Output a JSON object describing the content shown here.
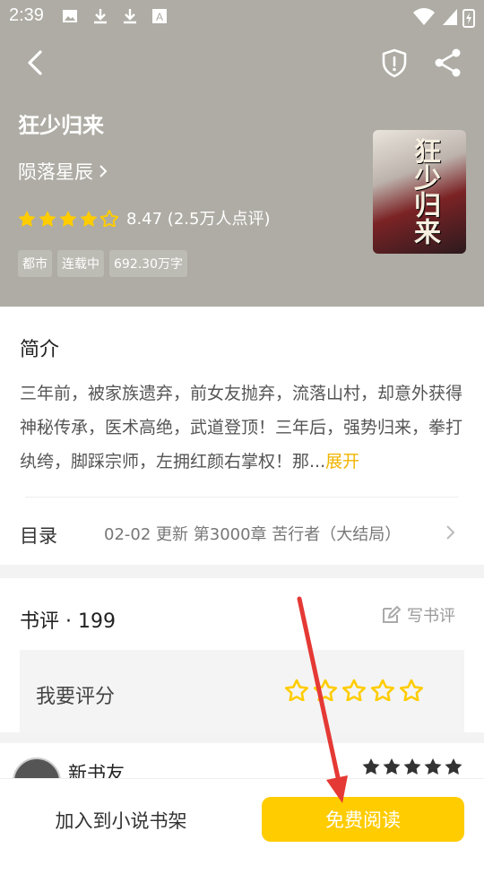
{
  "status_bar": {
    "time": "2:39"
  },
  "book": {
    "title": "狂少归来",
    "author": "陨落星辰",
    "rating_text": "8.47 (2.5万人点评)",
    "rating_stars": 4.5,
    "tags": [
      "都市",
      "连载中",
      "692.30万字"
    ],
    "cover_text": "狂少归来"
  },
  "intro": {
    "heading": "简介",
    "text": "三年前，被家族遗弃，前女友抛弃，流落山村，却意外获得神秘传承，医术高绝，武道登顶！三年后，强势归来，拳打纨绔，脚踩宗师，左拥红颜右掌权！那...",
    "expand_label": "展开"
  },
  "toc": {
    "label": "目录",
    "update": "02-02  更新  第3000章 苦行者（大结局）"
  },
  "reviews": {
    "heading": "书评 · 199",
    "write_label": "写书评",
    "rate_label": "我要评分",
    "first_user": "新书友",
    "first_user_stars": 5
  },
  "actions": {
    "add_shelf": "加入到小说书架",
    "read_free": "免费阅读"
  },
  "colors": {
    "header_bg": "#aeaca4",
    "accent": "#ffcc00",
    "star": "#ffcc00",
    "arrow": "#e53935"
  }
}
